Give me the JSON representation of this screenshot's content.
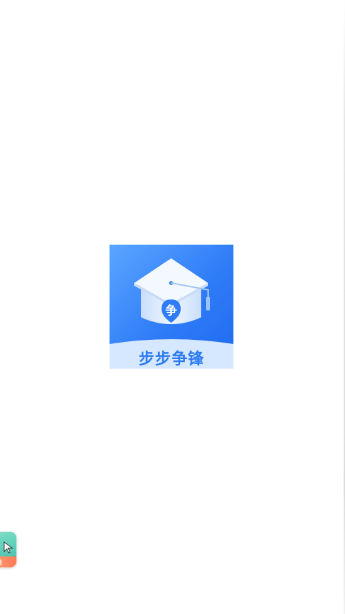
{
  "splash": {
    "app_name": "步步争锋",
    "logo_icon": "graduation-cap-icon",
    "emblem_char": "争"
  },
  "float_widget": {
    "icon": "cursor-icon",
    "label": "抢"
  },
  "colors": {
    "logo_blue_light": "#5aa6ff",
    "logo_blue_dark": "#1f6af0",
    "banner_bg": "#d6e8ff",
    "app_name_color": "#2c7bf2",
    "background": "#ffffff"
  }
}
